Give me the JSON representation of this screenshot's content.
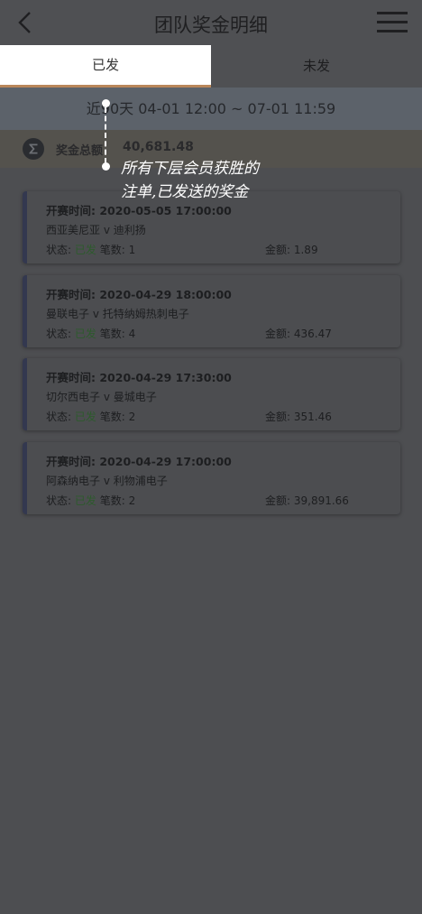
{
  "header": {
    "title": "团队奖金明细",
    "back_icon": "chevron-left-icon",
    "menu_icon": "hamburger-menu-icon"
  },
  "tabs": [
    {
      "label": "已发",
      "active": true
    },
    {
      "label": "未发",
      "active": false
    }
  ],
  "date_range": "近90天 04-01 12:00 ~ 07-01 11:59",
  "total": {
    "icon": "sigma-icon",
    "label": "奖金总额",
    "value": "40,681.48"
  },
  "orders": [
    {
      "time_label": "开赛时间: 2020-05-05 17:00:00",
      "match": "西亚美尼亚 v 迪利扬",
      "status_prefix": "状态:",
      "status_value": "已发",
      "count": "笔数: 1",
      "amount": "金额: 1.89"
    },
    {
      "time_label": "开赛时间: 2020-04-29 18:00:00",
      "match": "曼联电子 v 托特纳姆热刺电子",
      "status_prefix": "状态:",
      "status_value": "已发",
      "count": "笔数: 4",
      "amount": "金额: 436.47"
    },
    {
      "time_label": "开赛时间: 2020-04-29 17:30:00",
      "match": "切尔西电子 v 曼城电子",
      "status_prefix": "状态:",
      "status_value": "已发",
      "count": "笔数: 2",
      "amount": "金额: 351.46"
    },
    {
      "time_label": "开赛时间: 2020-04-29 17:00:00",
      "match": "阿森纳电子 v 利物浦电子",
      "status_prefix": "状态:",
      "status_value": "已发",
      "count": "笔数: 2",
      "amount": "金额: 39,891.66"
    }
  ],
  "annotation": {
    "line1": "所有下层会员获胜的",
    "line2": "注单,已发送的奖金"
  },
  "colors": {
    "accent": "#b9875a",
    "status_green": "#2d5a2c",
    "overlay_bg": "#4d4e51"
  }
}
